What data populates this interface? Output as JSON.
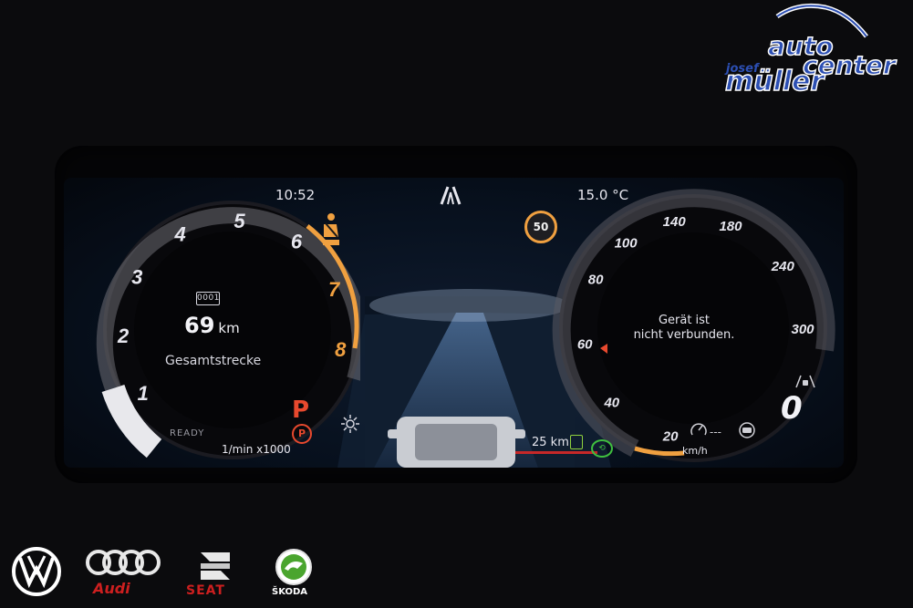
{
  "dealer": {
    "word1": "auto",
    "word2": "center",
    "first_name": "josef",
    "last_name": "müller"
  },
  "cluster": {
    "clock": "10:52",
    "temperature": "15.0 °C",
    "speed_limit": "50",
    "tachometer": {
      "ticks": [
        "1",
        "2",
        "3",
        "4",
        "5",
        "6",
        "7",
        "8"
      ],
      "redline_from": 7,
      "unit": "1/min x1000",
      "needle_value": 0,
      "ready_label": "READY",
      "accent_color": "#f0a040"
    },
    "odometer": {
      "icon_label": "0001",
      "value": "69",
      "unit": "km",
      "label": "Gesamtstrecke"
    },
    "gear": {
      "selected": "P",
      "parking_brake": "P",
      "drive_mode": "0"
    },
    "speedometer": {
      "ticks": [
        "20",
        "40",
        "60",
        "80",
        "100",
        "140",
        "180",
        "240",
        "300"
      ],
      "unit": "km/h",
      "message_line1": "Gerät ist",
      "message_line2": "nicht verbunden.",
      "marker_color": "#e8492e"
    },
    "range": {
      "value": "25 km",
      "low_fuel_color": "#8fd13e"
    },
    "acc": "---",
    "icons": [
      "seatbelt-warning-icon",
      "lane-assist-icon",
      "light-sensor-icon",
      "fuel-pump-icon",
      "green-mode-icon",
      "cruise-control-icon",
      "traffic-sign-icon",
      "lane-distance-icon"
    ]
  },
  "brands": [
    {
      "name": "vw",
      "label": ""
    },
    {
      "name": "audi",
      "label": "Audi"
    },
    {
      "name": "seat",
      "label": "SEAT"
    },
    {
      "name": "skoda",
      "label": "ŠKODA"
    }
  ],
  "colors": {
    "warning": "#f0a040",
    "alert_red": "#e8492e",
    "ok_green": "#3fbf3f",
    "dealer_blue": "#2c4fb3"
  }
}
